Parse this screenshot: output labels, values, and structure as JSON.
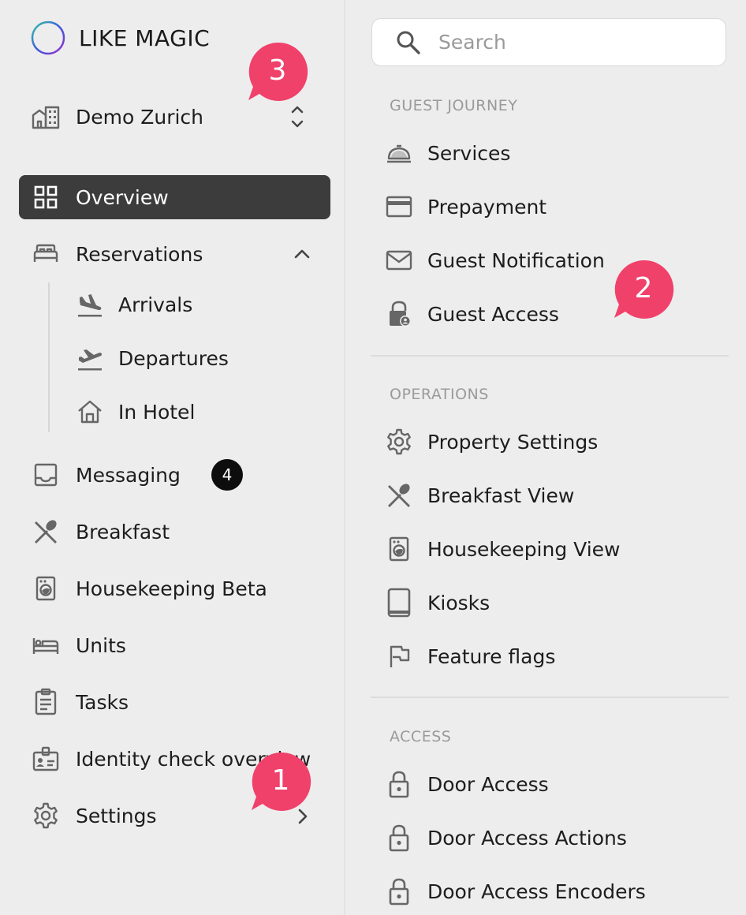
{
  "brand": {
    "name": "LIKE MAGIC"
  },
  "property": {
    "name": "Demo Zurich"
  },
  "nav": {
    "overview": "Overview",
    "reservations": "Reservations",
    "arrivals": "Arrivals",
    "departures": "Departures",
    "in_hotel": "In Hotel",
    "messaging": "Messaging",
    "messaging_count": "4",
    "breakfast": "Breakfast",
    "housekeeping": "Housekeeping Beta",
    "units": "Units",
    "tasks": "Tasks",
    "identity": "Identity check overview",
    "settings": "Settings"
  },
  "search": {
    "placeholder": "Search"
  },
  "sections": {
    "guest_journey": {
      "title": "GUEST JOURNEY",
      "items": [
        "Services",
        "Prepayment",
        "Guest Notification",
        "Guest Access"
      ]
    },
    "operations": {
      "title": "OPERATIONS",
      "items": [
        "Property Settings",
        "Breakfast View",
        "Housekeeping View",
        "Kiosks",
        "Feature flags"
      ]
    },
    "access": {
      "title": "ACCESS",
      "items": [
        "Door Access",
        "Door Access Actions",
        "Door Access Encoders"
      ]
    }
  },
  "callouts": {
    "one": "1",
    "two": "2",
    "three": "3"
  },
  "colors": {
    "active_bg": "#3c3c3c",
    "callout": "#f0416b",
    "badge": "#0d0d0d",
    "background": "#ededed"
  }
}
